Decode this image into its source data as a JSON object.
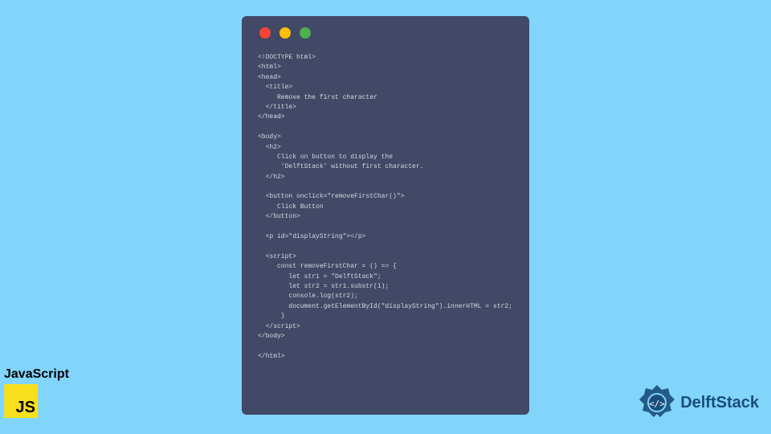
{
  "js_badge": {
    "label": "JavaScript",
    "logo_text": "JS"
  },
  "delftstack": {
    "text": "DelftStack"
  },
  "code": {
    "lines": "<!DOCTYPE html>\n<html>\n<head>\n  <title>\n     Remove the first character\n  </title>\n</head>\n\n<body>\n  <h2>\n     Click on button to display the\n      'DelftStack' without first character.\n  </h2>\n\n  <button onclick=\"removeFirstChar()\">\n     Click Button\n  </button>\n\n  <p id=\"displayString\"></p>\n\n  <script>\n     const removeFirstChar = () => {\n        let str1 = \"DelftStack\";\n        let str2 = str1.substr(1);\n        console.log(str2);\n        document.getElementById(\"displayString\").innerHTML = str2;\n      }\n  </script>\n</body>\n\n</html>"
  }
}
